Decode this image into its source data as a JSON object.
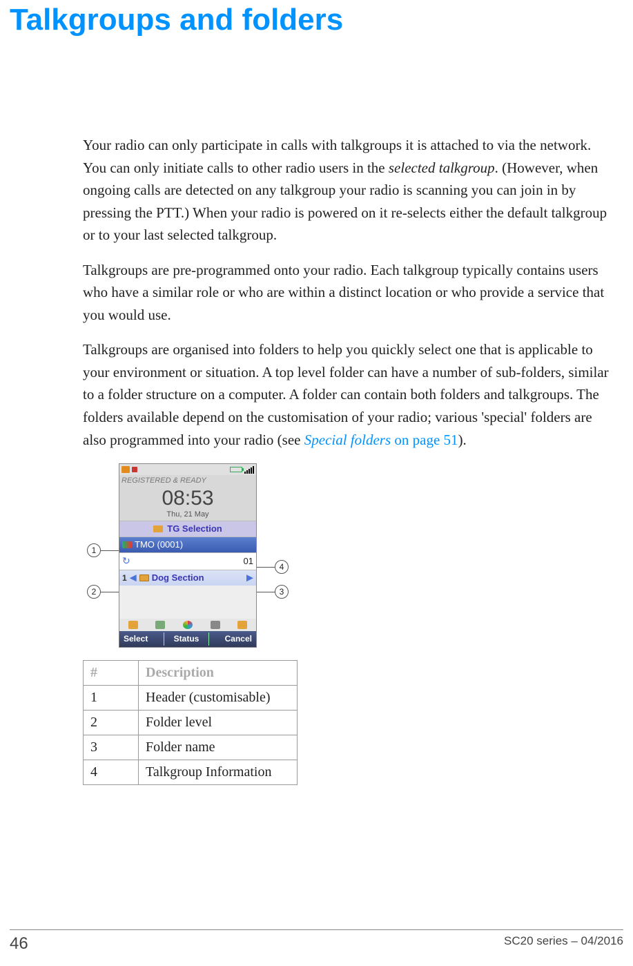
{
  "title": "Talkgroups and folders",
  "paragraphs": {
    "p1a": "Your radio can only participate in calls with talkgroups it is attached to via the network. You can only initiate calls to other radio users in the ",
    "p1b": "selected talkgroup",
    "p1c": ". (However, when ongoing calls are detected on any talkgroup your radio is scanning you can join in by pressing the PTT.) When your radio is powered on it re-selects either the default talkgroup or to your last selected talkgroup.",
    "p2": "Talkgroups are pre-programmed onto your radio. Each talkgroup typically contains users who have a similar role or who are within a distinct location or who provide a service that you would use.",
    "p3a": "Talkgroups are organised into folders to help you quickly select one that is applicable to your environment or situation. A top level folder can have a number of sub-folders, similar to a folder structure on a computer. A folder can contain both folders and talkgroups. The folders available depend on the customisation of your radio; various 'special' folders are also programmed into your radio (see ",
    "p3link": "Special folders",
    "p3tail": " on page 51",
    "p3end": ")."
  },
  "screen": {
    "registered": "REGISTERED & READY",
    "time": "08:53",
    "date": "Thu, 21 May",
    "tg_header": "TG Selection",
    "tmo": "TMO (0001)",
    "tmo_right": "01",
    "folder_level": "1",
    "folder_name": "Dog Section",
    "soft_left": "Select",
    "soft_mid": "Status",
    "soft_right": "Cancel"
  },
  "callouts": {
    "c1": "1",
    "c2": "2",
    "c3": "3",
    "c4": "4"
  },
  "table": {
    "h1": "#",
    "h2": "Description",
    "rows": [
      {
        "n": "1",
        "d": "Header (customisable)"
      },
      {
        "n": "2",
        "d": "Folder level"
      },
      {
        "n": "3",
        "d": "Folder name"
      },
      {
        "n": "4",
        "d": "Talkgroup Information"
      }
    ]
  },
  "footer": {
    "page": "46",
    "doc": "SC20 series – 04/2016"
  }
}
